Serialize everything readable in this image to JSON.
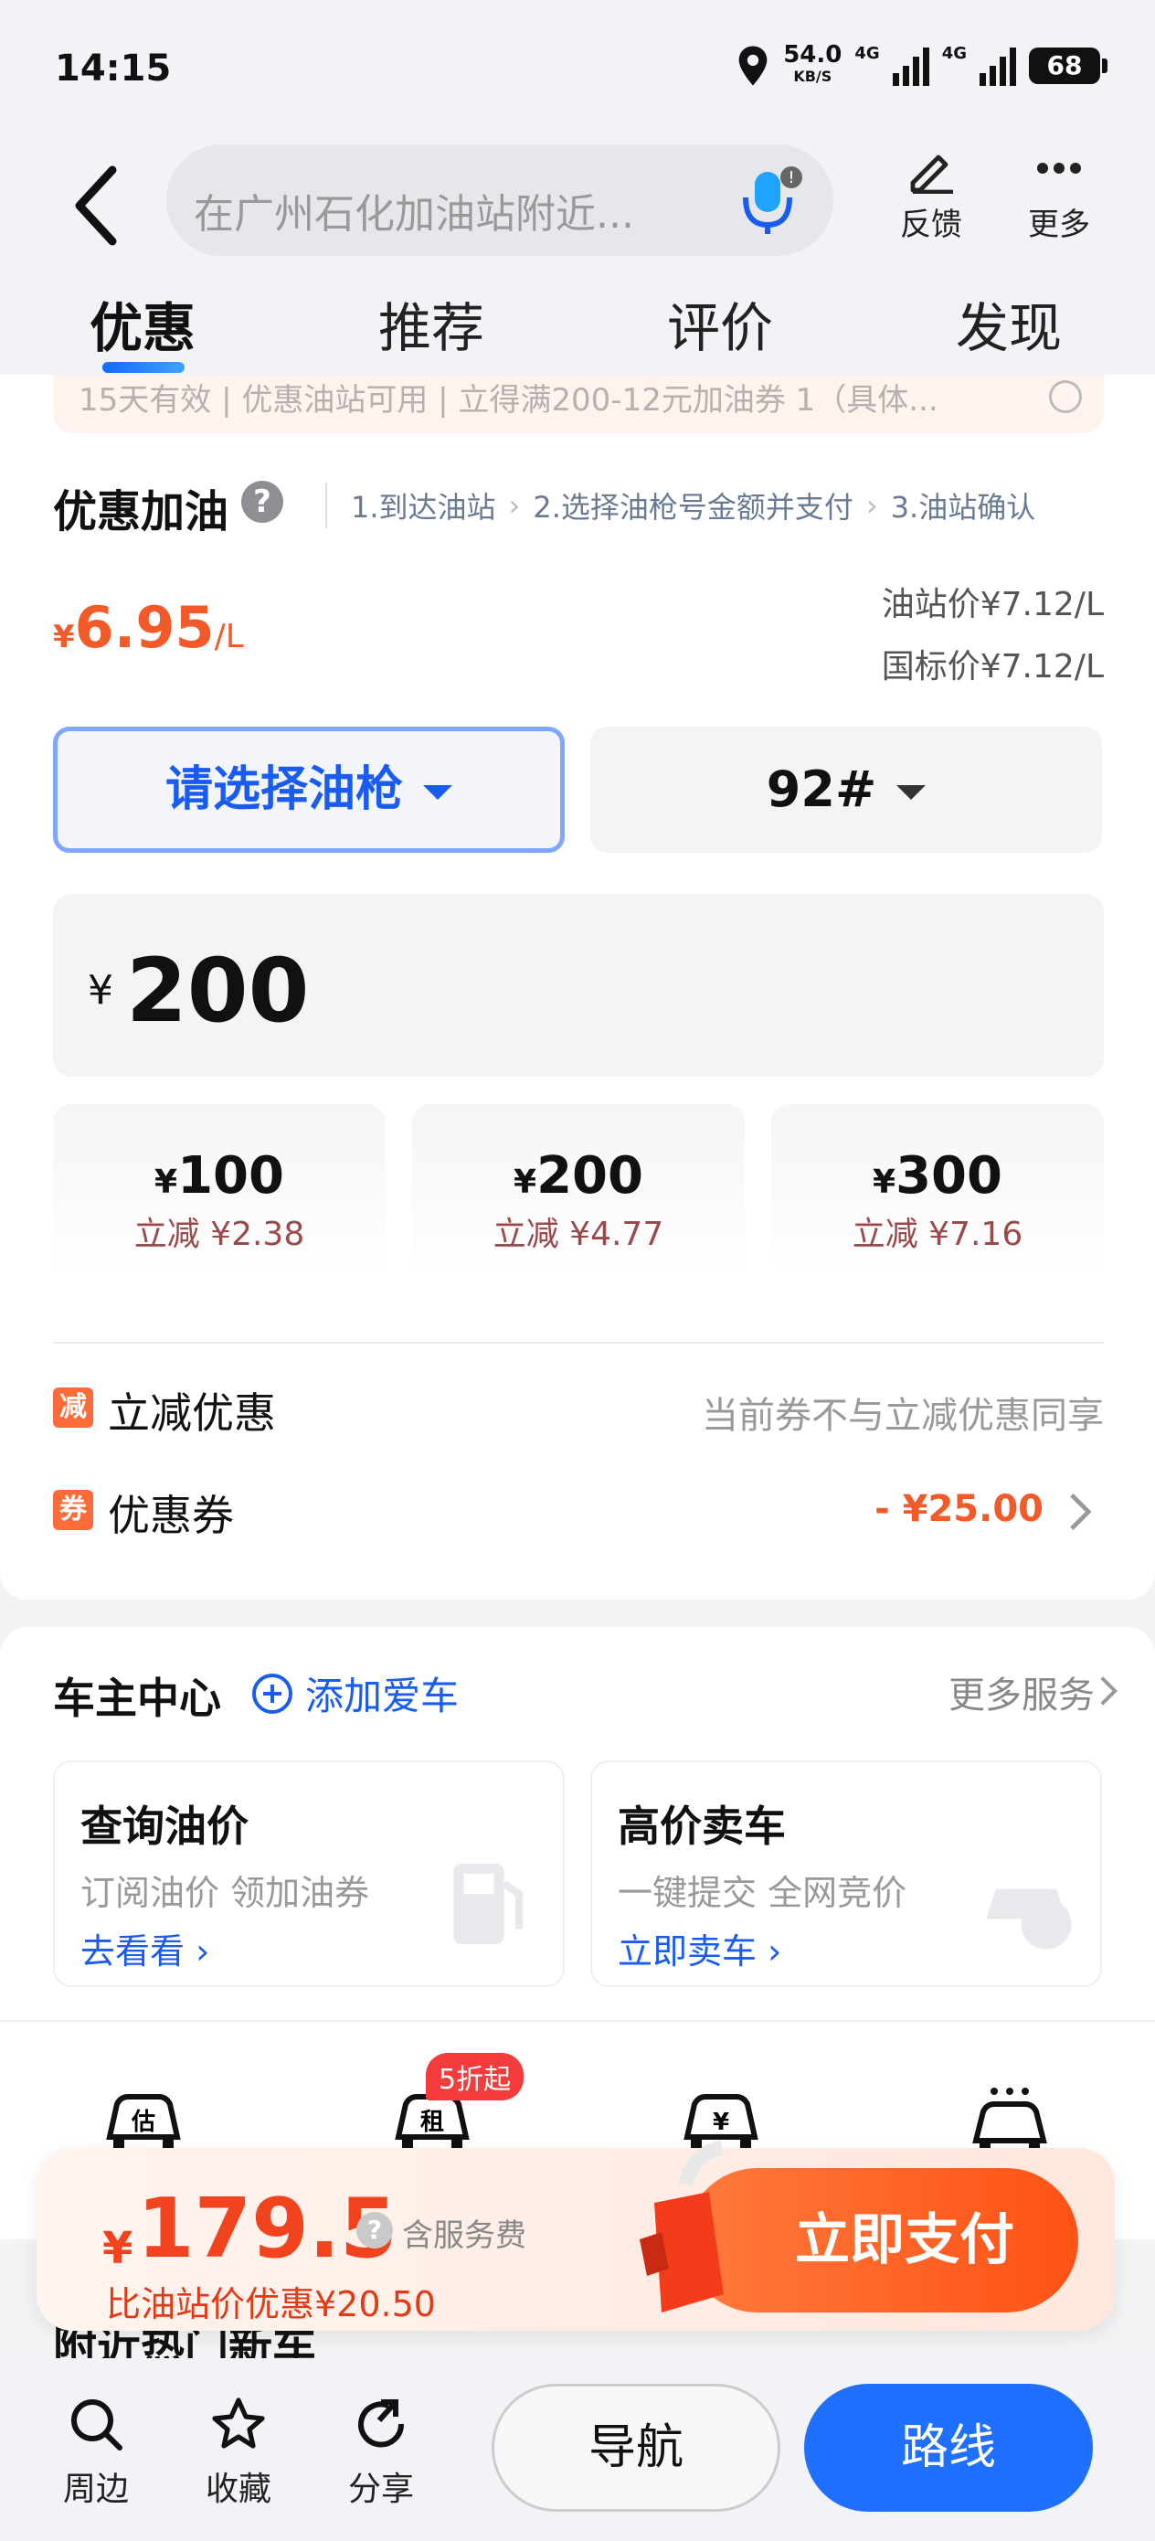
{
  "status_bar": {
    "time": "14:15",
    "speed": "54.0",
    "speed_unit": "KB/S",
    "net1": "4G",
    "net2": "4G",
    "battery": "68"
  },
  "header": {
    "search_placeholder": "在广州石化加油站附近...",
    "feedback_label": "反馈",
    "more_label": "更多"
  },
  "tabs": [
    "优惠",
    "推荐",
    "评价",
    "发现"
  ],
  "notice": "15天有效 | 优惠油站可用 | 立得满200-12元加油券 1（具体...",
  "fuel_section": {
    "title": "优惠加油",
    "steps": [
      "1.到达油站",
      "2.选择油枪号金额并支付",
      "3.油站确认"
    ],
    "price_currency": "¥",
    "price_value": "6.95",
    "price_unit": "/L",
    "station_price": "油站价¥7.12/L",
    "national_price": "国标价¥7.12/L",
    "gun_select": "请选择油枪",
    "fuel_type": "92#",
    "amount_currency": "¥",
    "amount_value": "200",
    "options": [
      {
        "currency": "¥",
        "amount": "100",
        "discount": "立减 ¥2.38"
      },
      {
        "currency": "¥",
        "amount": "200",
        "discount": "立减 ¥4.77"
      },
      {
        "currency": "¥",
        "amount": "300",
        "discount": "立减 ¥7.16"
      }
    ],
    "instant_tag": "减",
    "instant_label": "立减优惠",
    "instant_note": "当前券不与立减优惠同享",
    "coupon_tag": "券",
    "coupon_label": "优惠券",
    "coupon_value": "- ¥25.00"
  },
  "owner_center": {
    "title": "车主中心",
    "add_car": "添加爱车",
    "more_services": "更多服务",
    "cards": [
      {
        "title": "查询油价",
        "subtitle": "订阅油价 领加油券",
        "link": "去看看"
      },
      {
        "title": "高价卖车",
        "subtitle": "一键提交 全网竞价",
        "link": "立即卖车"
      }
    ]
  },
  "icon_strip": {
    "icons": [
      "估",
      "租",
      "¥",
      ""
    ],
    "badge": "5折起"
  },
  "nearby_title": "附近热门新车",
  "pay_bar": {
    "currency": "¥",
    "amount": "179.5",
    "fee_note": "含服务费",
    "saving": "比油站价优惠¥20.50",
    "pay_button": "立即支付"
  },
  "bottom_bar": {
    "around": "周边",
    "favorite": "收藏",
    "share": "分享",
    "navigate": "导航",
    "route": "路线"
  },
  "colors": {
    "accent_blue": "#1a5cf2",
    "accent_orange": "#f25a2a",
    "route_blue": "#1f70ff"
  }
}
